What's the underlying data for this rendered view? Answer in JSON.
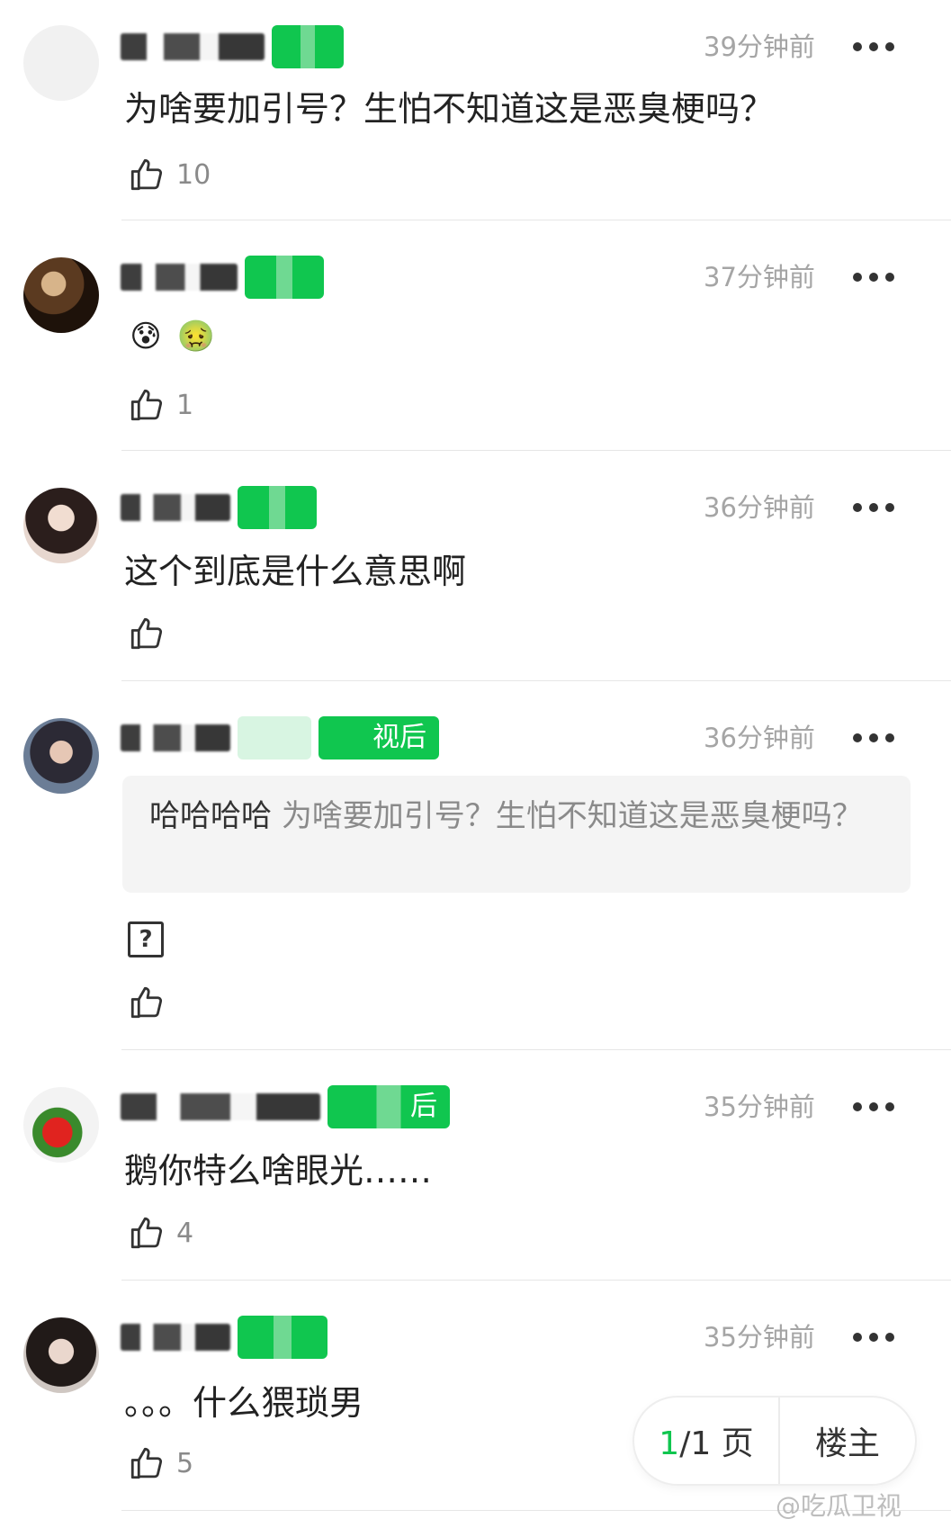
{
  "comments": [
    {
      "time": "39分钟前",
      "text": "为啥要加引号？生怕不知道这是恶臭梗吗？",
      "likes": "10",
      "badges": [
        ""
      ]
    },
    {
      "time": "37分钟前",
      "emojis": [
        "😰",
        "🤢"
      ],
      "likes": "1",
      "badges": [
        ""
      ]
    },
    {
      "time": "36分钟前",
      "text": "这个到底是什么意思啊",
      "likes": "",
      "badges": [
        ""
      ]
    },
    {
      "time": "36分钟前",
      "badges": [
        "",
        "视后"
      ],
      "quote": {
        "reply": "哈哈哈哈",
        "original": "为啥要加引号？生怕不知道这是恶臭梗吗？"
      },
      "image_placeholder": "?",
      "likes": ""
    },
    {
      "time": "35分钟前",
      "text": "鹅你特么啥眼光……",
      "likes": "4",
      "badges": [
        "后"
      ]
    },
    {
      "time": "35分钟前",
      "text": "。。。什么猥琐男",
      "likes": "5",
      "badges": [
        ""
      ]
    }
  ],
  "pager": {
    "current": "1",
    "rest": "/1 页",
    "op_label": "楼主"
  },
  "watermark": "@吃瓜卫视",
  "colors": {
    "accent": "#10c64f",
    "time": "#a5a5a5"
  },
  "icons": [
    "thumbs-up-icon",
    "more-icon",
    "question-icon"
  ]
}
